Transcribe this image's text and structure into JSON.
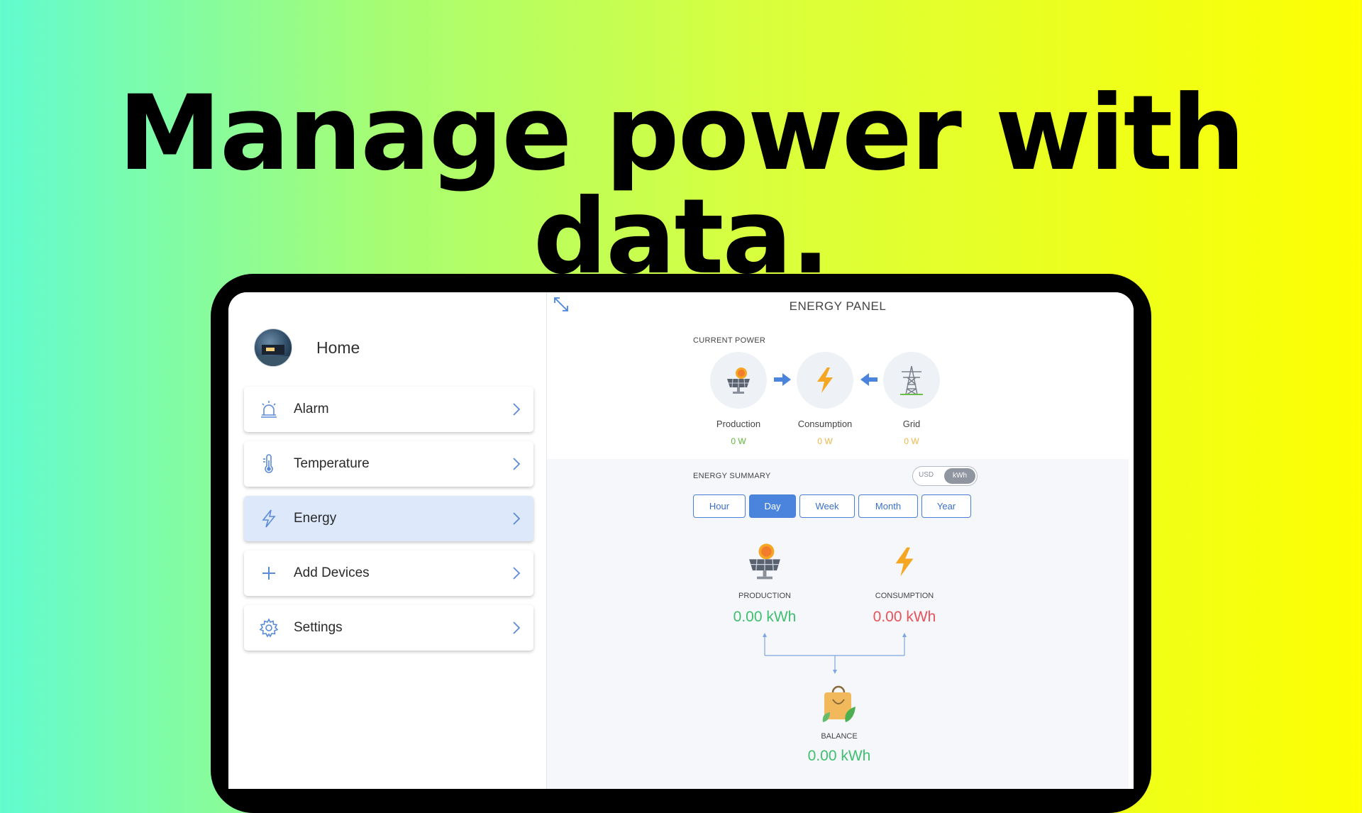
{
  "headline": "Manage power with data.",
  "sidebar": {
    "home_label": "Home",
    "items": [
      {
        "label": "Alarm",
        "icon": "alarm-icon",
        "active": false
      },
      {
        "label": "Temperature",
        "icon": "thermometer-icon",
        "active": false
      },
      {
        "label": "Energy",
        "icon": "lightning-icon",
        "active": true
      },
      {
        "label": "Add Devices",
        "icon": "plus-icon",
        "active": false
      },
      {
        "label": "Settings",
        "icon": "gear-icon",
        "active": false
      }
    ]
  },
  "panel": {
    "title": "ENERGY PANEL",
    "current_power": {
      "label": "CURRENT POWER",
      "production": {
        "label": "Production",
        "value": "0 W"
      },
      "consumption": {
        "label": "Consumption",
        "value": "0 W"
      },
      "grid": {
        "label": "Grid",
        "value": "0 W"
      }
    },
    "summary": {
      "label": "ENERGY SUMMARY",
      "toggle": {
        "usd": "USD",
        "kwh": "kWh",
        "selected": "kWh"
      },
      "tabs": [
        "Hour",
        "Day",
        "Week",
        "Month",
        "Year"
      ],
      "active_tab": "Day",
      "production": {
        "label": "PRODUCTION",
        "value": "0.00 kWh"
      },
      "consumption": {
        "label": "CONSUMPTION",
        "value": "0.00 kWh"
      },
      "balance": {
        "label": "BALANCE",
        "value": "0.00 kWh"
      }
    }
  },
  "colors": {
    "accent": "#4a84dd",
    "production_green": "#3fbf6f",
    "consumption_red": "#e8535a",
    "value_orange": "#f0b74a",
    "value_green": "#5fb83a"
  }
}
